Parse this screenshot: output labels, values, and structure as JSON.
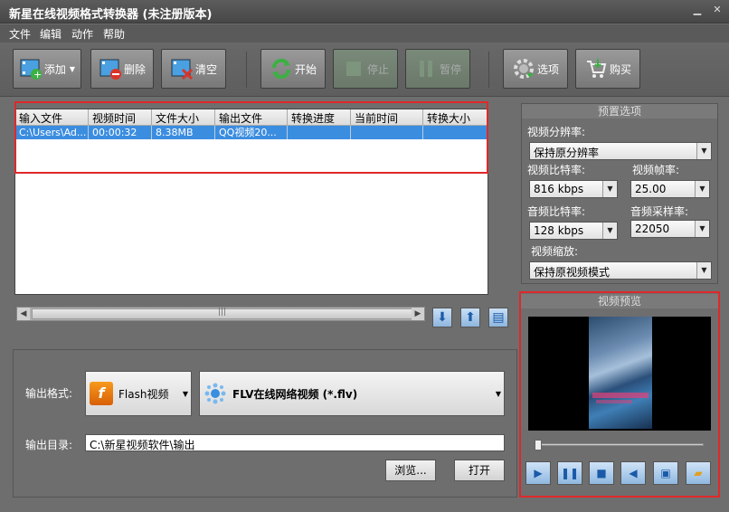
{
  "window": {
    "title": "新星在线视频格式转换器 (未注册版本)",
    "minimize": "▁",
    "close": "✕"
  },
  "menu": [
    "文件",
    "编辑",
    "动作",
    "帮助"
  ],
  "toolbar": {
    "add": "添加",
    "delete": "删除",
    "clear": "清空",
    "start": "开始",
    "stop": "停止",
    "pause": "暂停",
    "options": "选项",
    "buy": "购买"
  },
  "filelist": {
    "columns": [
      "输入文件",
      "视频时间",
      "文件大小",
      "输出文件",
      "转换进度",
      "当前时间",
      "转换大小"
    ],
    "rows": [
      [
        "C:\\Users\\Ad...",
        "00:00:32",
        "8.38MB",
        "QQ视频20...",
        "",
        "",
        ""
      ]
    ]
  },
  "scroll": {
    "left": "◀",
    "right": "▶",
    "grip": "|||"
  },
  "list_buttons": {
    "down": "⬇",
    "up": "⬆",
    "clipboard": "▤"
  },
  "output": {
    "format_label": "输出格式:",
    "format_type": "Flash视频",
    "format_detail": "FLV在线网络视频 (*.flv)",
    "dir_label": "输出目录:",
    "dir_value": "C:\\新星视频软件\\输出",
    "browse": "浏览...",
    "open": "打开"
  },
  "preset": {
    "title": "预置选项",
    "resolution_label": "视频分辨率:",
    "resolution": "保持原分辨率",
    "vbitrate_label": "视频比特率:",
    "vbitrate": "816 kbps",
    "fps_label": "视频帧率:",
    "fps": "25.00",
    "abitrate_label": "音频比特率:",
    "abitrate": "128 kbps",
    "samplerate_label": "音频采样率:",
    "samplerate": "22050",
    "scale_label": "视频缩放:",
    "scale": "保持原视频模式"
  },
  "preview": {
    "title": "视频预览",
    "controls": [
      "play-icon",
      "pause-icon",
      "stop-icon",
      "volume-icon",
      "snapshot-icon",
      "folder-icon"
    ]
  }
}
